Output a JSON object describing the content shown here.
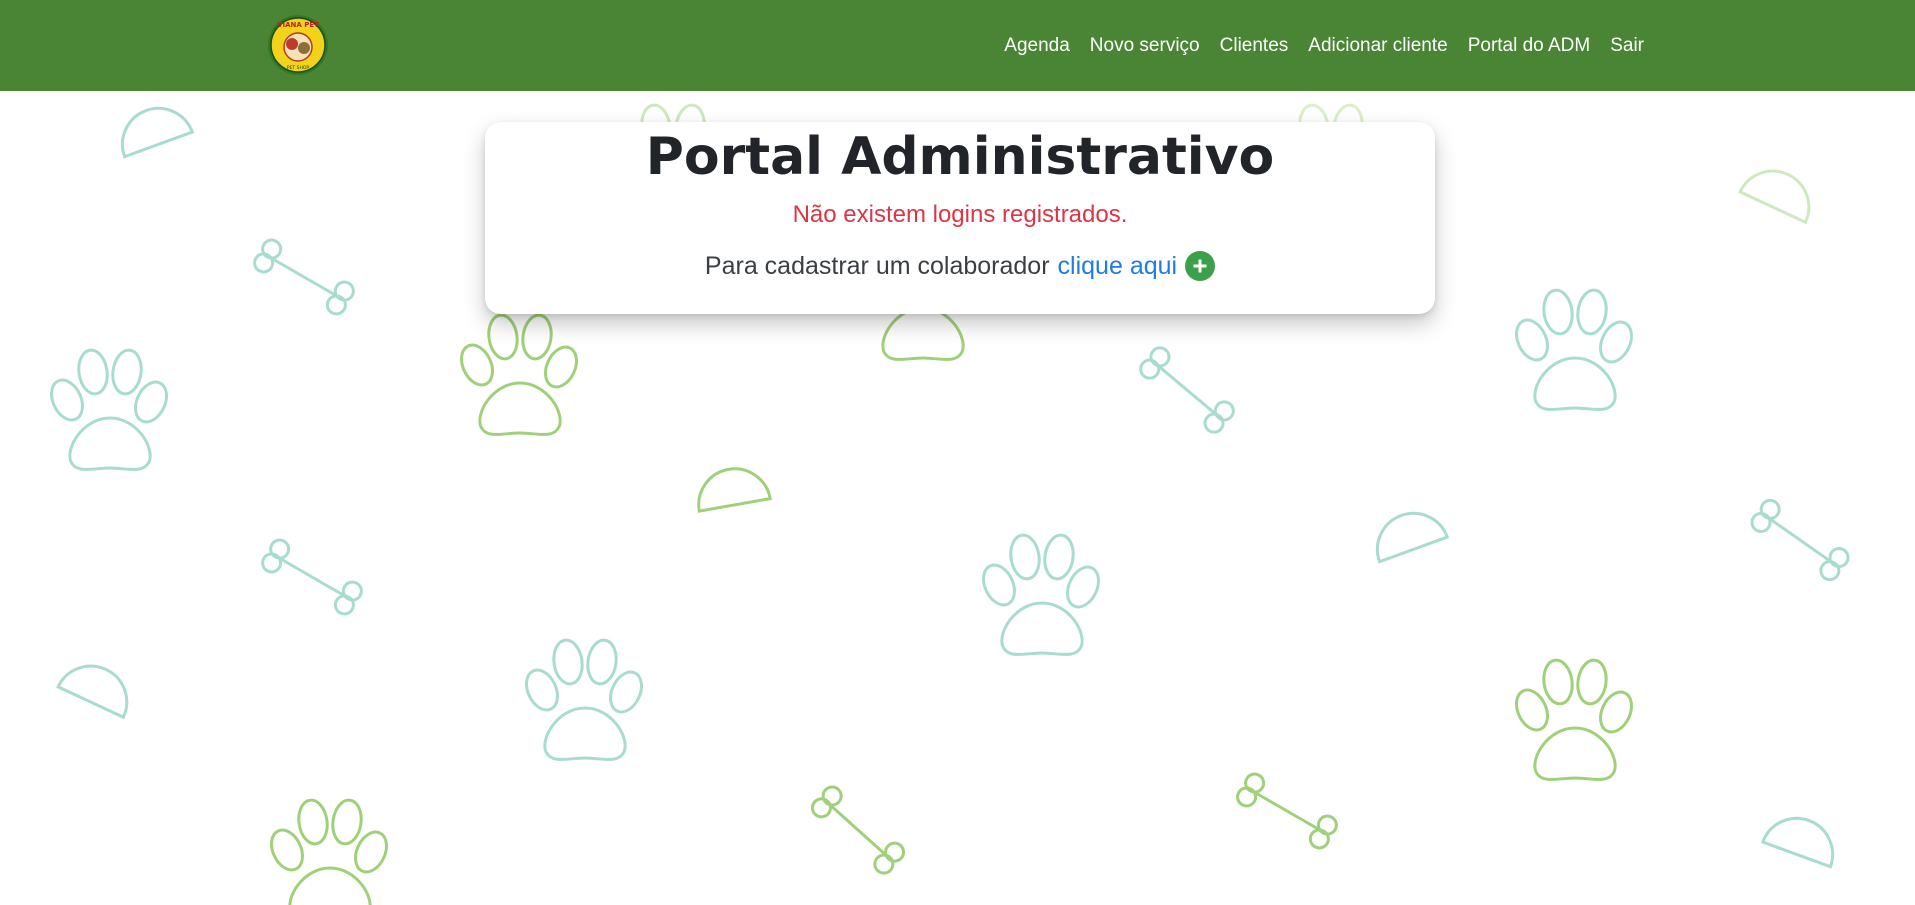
{
  "brand": {
    "logo_icon": "viana-pet-logo-icon",
    "logo_text": "VIANA PET",
    "logo_subtext": "PET SHOP"
  },
  "nav": {
    "items": [
      {
        "label": "Agenda"
      },
      {
        "label": "Novo serviço"
      },
      {
        "label": "Clientes"
      },
      {
        "label": "Adicionar cliente"
      },
      {
        "label": "Portal do ADM"
      },
      {
        "label": "Sair"
      }
    ]
  },
  "card": {
    "title": "Portal Administrativo",
    "error_message": "Não existem logins registrados.",
    "cta_text": "Para cadastrar um colaborador",
    "cta_link": "clique aqui",
    "cta_icon": "plus-circle-icon"
  },
  "colors": {
    "navbar": "#4a8536",
    "error": "#dc3545",
    "link": "#1e7ce6",
    "plus_button": "#3aa14a",
    "pattern_green": "#9fd07a",
    "pattern_teal": "#a8dcd0"
  }
}
